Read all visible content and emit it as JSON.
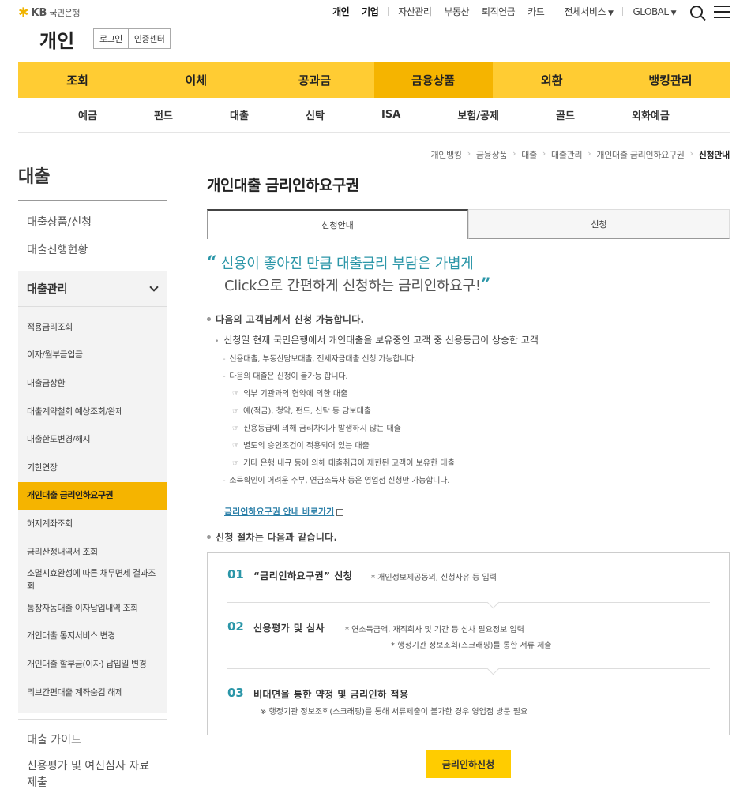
{
  "header": {
    "logo_kb": "KB",
    "logo_bank": "국민은행",
    "site_title": "개인",
    "login": "로그인",
    "cert": "인증센터",
    "top_links": [
      "개인",
      "기업",
      "자산관리",
      "부동산",
      "퇴직연금",
      "카드",
      "전체서비스",
      "GLOBAL"
    ]
  },
  "gnb": [
    "조회",
    "이체",
    "공과금",
    "금융상품",
    "외환",
    "뱅킹관리"
  ],
  "subnav": [
    "예금",
    "펀드",
    "대출",
    "신탁",
    "ISA",
    "보험/공제",
    "골드",
    "외화예금"
  ],
  "lnb": {
    "title": "대출",
    "items_top": [
      "대출상품/신청",
      "대출진행현황"
    ],
    "group_title": "대출관리",
    "group_items": [
      "적용금리조회",
      "이자/월부금입금",
      "대출금상환",
      "대출계약철회 예상조회/완제",
      "대출한도변경/해지",
      "기한연장",
      "개인대출 금리인하요구권",
      "해지계좌조회",
      "금리산정내역서 조회",
      "소멸시효완성에 따른 채무면제 결과조회",
      "통장자동대출 이자납입내역 조회",
      "개인대출 통지서비스 변경",
      "개인대출 할부금(이자) 납입일 변경",
      "리브간편대출 계좌숨김 해제"
    ],
    "items_bottom": [
      "대출 가이드",
      "신용평가 및 여신심사 자료 제출"
    ]
  },
  "breadcrumb": [
    "개인뱅킹",
    "금융상품",
    "대출",
    "대출관리",
    "개인대출 금리인하요구권",
    "신청안내"
  ],
  "page": {
    "title": "개인대출 금리인하요구권",
    "tabs": [
      "신청안내",
      "신청"
    ],
    "quote_open": "“",
    "quote_close": "”",
    "quote_line1": "신용이 좋아진 만큼 대출금리 부담은 가볍게",
    "quote_line2": "Click으로 간편하게 신청하는 금리인하요구!",
    "section1": "다음의 고객님께서 신청 가능합니다.",
    "cond_main": "신청일 현재 국민은행에서 개인대출을 보유중인 고객 중 신용등급이 상승한 고객",
    "cond_sub1": "신용대출, 부동산담보대출, 전세자금대출 신청 가능합니다.",
    "cond_sub2": "다음의 대출은 신청이 불가능 합니다.",
    "cond_hands": [
      "외부 기관과의 협약에 의한 대출",
      "예(적금), 청약, 펀드, 신탁 등 담보대출",
      "신용등급에 의해 금리차이가 발생하지 않는 대출",
      "별도의 승인조건이 적용되어 있는 대출",
      "기타 은행 내규 등에 의해 대출취급이 제한된 고객이 보유한 대출"
    ],
    "cond_sub3": "소득확인이 어려운 주부, 연금소득자 등은 영업점 신청만 가능합니다.",
    "guide_link": "금리인하요구권 안내 바로가기",
    "section2": "신청 절차는 다음과 같습니다.",
    "steps": [
      {
        "num": "01",
        "title": "“금리인하요구권” 신청",
        "desc1": "* 개인정보제공동의, 신청사유 등 입력",
        "desc2": ""
      },
      {
        "num": "02",
        "title": "신용평가 및 심사",
        "desc1": "* 연소득금액, 재직회사 및 기간 등 심사 필요정보 입력",
        "desc2": "* 행정기관 정보조회(스크래핑)를 통한 서류 제출"
      },
      {
        "num": "03",
        "title": "비대면을 통한 약정 및 금리인하 적용",
        "desc1": "",
        "desc2": "※ 행정기관 정보조회(스크래핑)를 통해 서류제출이 불가한 경우 영업점 방문 필요"
      }
    ],
    "apply_button": "금리인하신청"
  }
}
